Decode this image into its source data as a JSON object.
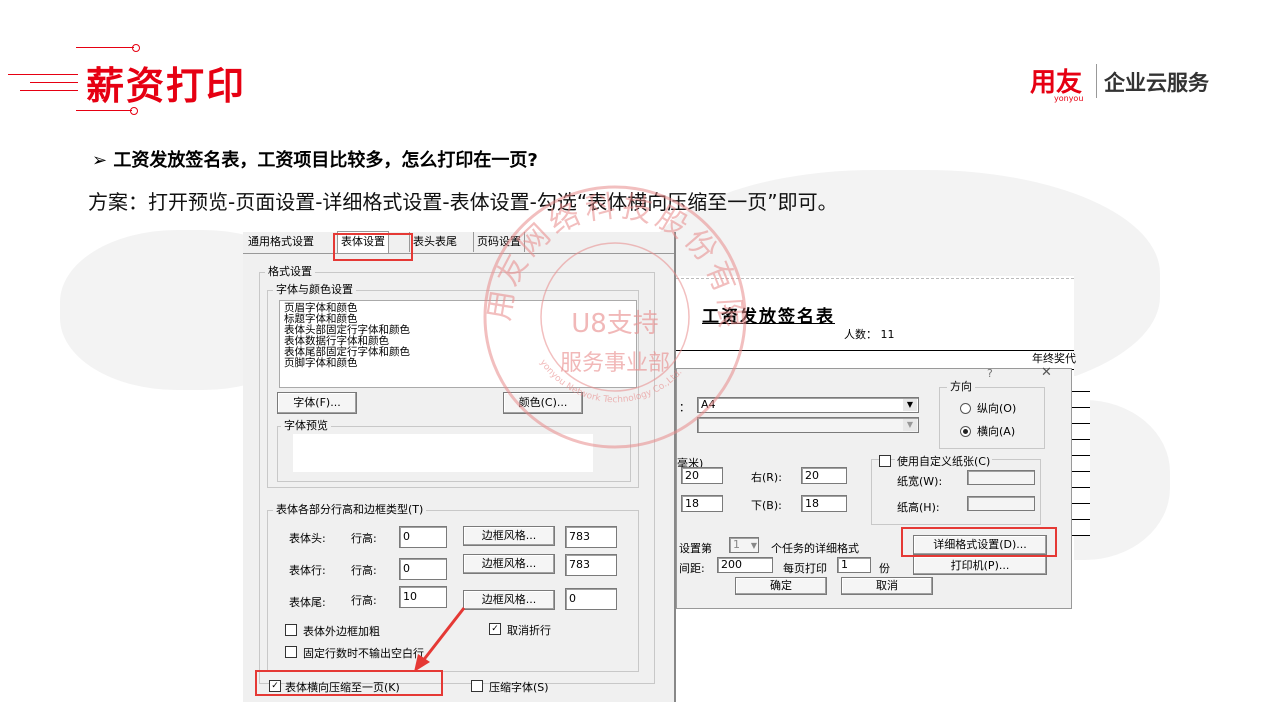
{
  "header": {
    "title": "薪资打印",
    "logo_main": "用友",
    "logo_sub": "yonyou",
    "logo_text": "企业云服务"
  },
  "question": "工资发放签名表，工资项目比较多，怎么打印在一页?",
  "answer": "方案：打开预览-页面设置-详细格式设置-表体设置-勾选“表体横向压缩至一页”即可。",
  "stamp": {
    "outer": "用友网络科技股份有限公司",
    "center1": "U8支持",
    "center2": "服务事业部",
    "english": "yonyou Network Technology Co.,Ltd."
  },
  "left_dialog": {
    "tabs": [
      "通用格式设置",
      "表体设置",
      "表头表尾",
      "页码设置"
    ],
    "format_group": "格式设置",
    "font_color_group": "字体与颜色设置",
    "font_list": [
      "页眉字体和颜色",
      "标题字体和颜色",
      "表体头部固定行字体和颜色",
      "表体数据行字体和颜色",
      "表体尾部固定行字体和颜色",
      "页脚字体和颜色"
    ],
    "font_button": "字体(F)...",
    "color_button": "颜色(C)...",
    "preview_group": "字体预览",
    "row_group": "表体各部分行高和边框类型(T)",
    "rows": [
      {
        "name": "表体头:",
        "height_label": "行高:",
        "height": "0",
        "border_button": "边框风格...",
        "border_value": "783"
      },
      {
        "name": "表体行:",
        "height_label": "行高:",
        "height": "0",
        "border_button": "边框风格...",
        "border_value": "783"
      },
      {
        "name": "表体尾:",
        "height_label": "行高:",
        "height": "10",
        "border_button": "边框风格...",
        "border_value": "0"
      }
    ],
    "check_outer_border": "表体外边框加粗",
    "check_cancel_wrap": "取消折行",
    "check_fixed_rows": "固定行数时不输出空白行",
    "check_compress_horizontal": "表体横向压缩至一页(K)",
    "check_compress_font": "压缩字体(S)"
  },
  "right_dialog": {
    "report_title": "工资发放签名表",
    "headcount_label": "人数：",
    "headcount": "11",
    "header_fragment": "年终奖代",
    "window_help": "?",
    "window_close": "✕",
    "paper_size_prefix": "：",
    "paper_size": "A4",
    "orientation_group": "方向",
    "portrait": "纵向(O)",
    "landscape": "横向(A)",
    "margin_unit": "毫米)",
    "top_value": "20",
    "right_label": "右(R):",
    "right_value": "20",
    "bottom_left_value": "18",
    "bottom_label": "下(B):",
    "bottom_value": "18",
    "custom_paper": "使用自定义纸张(C)",
    "paper_width": "纸宽(W):",
    "paper_height": "纸高(H):",
    "task_prefix": "设置第",
    "task_num": "1",
    "task_suffix": "个任务的详细格式",
    "detail_button": "详细格式设置(D)...",
    "spacing_label": "间距:",
    "spacing_value": "200",
    "copies_label": "每页打印",
    "copies_value": "1",
    "copies_unit": "份",
    "printer_button": "打印机(P)...",
    "ok_button": "确定",
    "cancel_button": "取消"
  }
}
